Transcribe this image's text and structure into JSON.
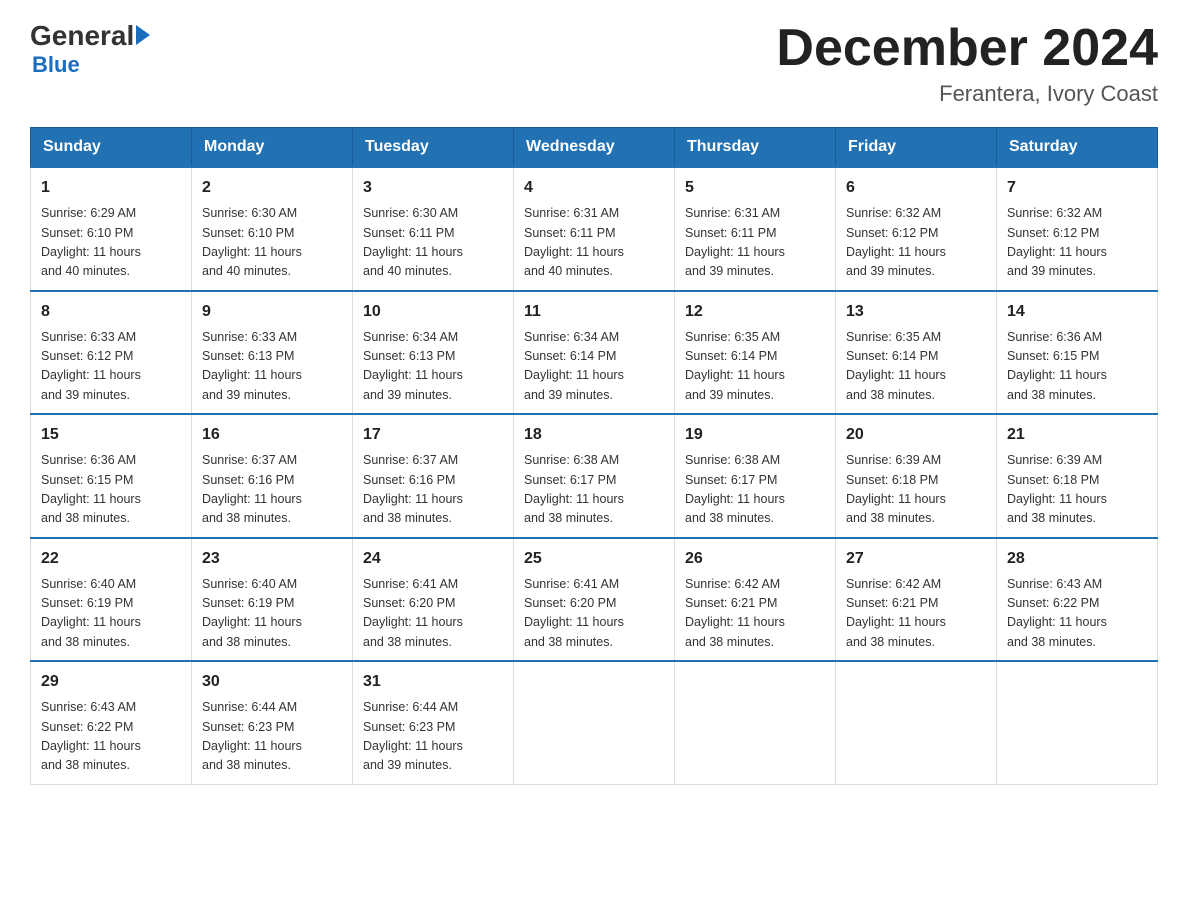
{
  "header": {
    "logo": {
      "general": "General",
      "blue": "Blue"
    },
    "title": "December 2024",
    "location": "Ferantera, Ivory Coast"
  },
  "calendar": {
    "days_of_week": [
      "Sunday",
      "Monday",
      "Tuesday",
      "Wednesday",
      "Thursday",
      "Friday",
      "Saturday"
    ],
    "weeks": [
      [
        {
          "day": "1",
          "sunrise": "6:29 AM",
          "sunset": "6:10 PM",
          "daylight": "11 hours and 40 minutes."
        },
        {
          "day": "2",
          "sunrise": "6:30 AM",
          "sunset": "6:10 PM",
          "daylight": "11 hours and 40 minutes."
        },
        {
          "day": "3",
          "sunrise": "6:30 AM",
          "sunset": "6:11 PM",
          "daylight": "11 hours and 40 minutes."
        },
        {
          "day": "4",
          "sunrise": "6:31 AM",
          "sunset": "6:11 PM",
          "daylight": "11 hours and 40 minutes."
        },
        {
          "day": "5",
          "sunrise": "6:31 AM",
          "sunset": "6:11 PM",
          "daylight": "11 hours and 39 minutes."
        },
        {
          "day": "6",
          "sunrise": "6:32 AM",
          "sunset": "6:12 PM",
          "daylight": "11 hours and 39 minutes."
        },
        {
          "day": "7",
          "sunrise": "6:32 AM",
          "sunset": "6:12 PM",
          "daylight": "11 hours and 39 minutes."
        }
      ],
      [
        {
          "day": "8",
          "sunrise": "6:33 AM",
          "sunset": "6:12 PM",
          "daylight": "11 hours and 39 minutes."
        },
        {
          "day": "9",
          "sunrise": "6:33 AM",
          "sunset": "6:13 PM",
          "daylight": "11 hours and 39 minutes."
        },
        {
          "day": "10",
          "sunrise": "6:34 AM",
          "sunset": "6:13 PM",
          "daylight": "11 hours and 39 minutes."
        },
        {
          "day": "11",
          "sunrise": "6:34 AM",
          "sunset": "6:14 PM",
          "daylight": "11 hours and 39 minutes."
        },
        {
          "day": "12",
          "sunrise": "6:35 AM",
          "sunset": "6:14 PM",
          "daylight": "11 hours and 39 minutes."
        },
        {
          "day": "13",
          "sunrise": "6:35 AM",
          "sunset": "6:14 PM",
          "daylight": "11 hours and 38 minutes."
        },
        {
          "day": "14",
          "sunrise": "6:36 AM",
          "sunset": "6:15 PM",
          "daylight": "11 hours and 38 minutes."
        }
      ],
      [
        {
          "day": "15",
          "sunrise": "6:36 AM",
          "sunset": "6:15 PM",
          "daylight": "11 hours and 38 minutes."
        },
        {
          "day": "16",
          "sunrise": "6:37 AM",
          "sunset": "6:16 PM",
          "daylight": "11 hours and 38 minutes."
        },
        {
          "day": "17",
          "sunrise": "6:37 AM",
          "sunset": "6:16 PM",
          "daylight": "11 hours and 38 minutes."
        },
        {
          "day": "18",
          "sunrise": "6:38 AM",
          "sunset": "6:17 PM",
          "daylight": "11 hours and 38 minutes."
        },
        {
          "day": "19",
          "sunrise": "6:38 AM",
          "sunset": "6:17 PM",
          "daylight": "11 hours and 38 minutes."
        },
        {
          "day": "20",
          "sunrise": "6:39 AM",
          "sunset": "6:18 PM",
          "daylight": "11 hours and 38 minutes."
        },
        {
          "day": "21",
          "sunrise": "6:39 AM",
          "sunset": "6:18 PM",
          "daylight": "11 hours and 38 minutes."
        }
      ],
      [
        {
          "day": "22",
          "sunrise": "6:40 AM",
          "sunset": "6:19 PM",
          "daylight": "11 hours and 38 minutes."
        },
        {
          "day": "23",
          "sunrise": "6:40 AM",
          "sunset": "6:19 PM",
          "daylight": "11 hours and 38 minutes."
        },
        {
          "day": "24",
          "sunrise": "6:41 AM",
          "sunset": "6:20 PM",
          "daylight": "11 hours and 38 minutes."
        },
        {
          "day": "25",
          "sunrise": "6:41 AM",
          "sunset": "6:20 PM",
          "daylight": "11 hours and 38 minutes."
        },
        {
          "day": "26",
          "sunrise": "6:42 AM",
          "sunset": "6:21 PM",
          "daylight": "11 hours and 38 minutes."
        },
        {
          "day": "27",
          "sunrise": "6:42 AM",
          "sunset": "6:21 PM",
          "daylight": "11 hours and 38 minutes."
        },
        {
          "day": "28",
          "sunrise": "6:43 AM",
          "sunset": "6:22 PM",
          "daylight": "11 hours and 38 minutes."
        }
      ],
      [
        {
          "day": "29",
          "sunrise": "6:43 AM",
          "sunset": "6:22 PM",
          "daylight": "11 hours and 38 minutes."
        },
        {
          "day": "30",
          "sunrise": "6:44 AM",
          "sunset": "6:23 PM",
          "daylight": "11 hours and 38 minutes."
        },
        {
          "day": "31",
          "sunrise": "6:44 AM",
          "sunset": "6:23 PM",
          "daylight": "11 hours and 39 minutes."
        },
        null,
        null,
        null,
        null
      ]
    ],
    "labels": {
      "sunrise": "Sunrise:",
      "sunset": "Sunset:",
      "daylight": "Daylight:"
    }
  }
}
